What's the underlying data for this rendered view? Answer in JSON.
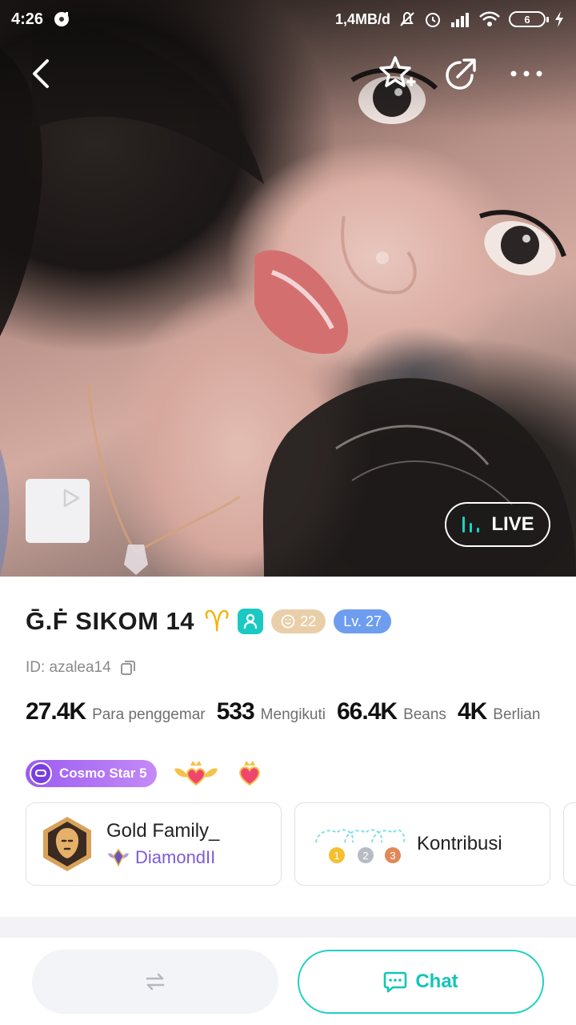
{
  "status_bar": {
    "time": "4:26",
    "network_speed": "1,4MB/d",
    "battery_level": "6"
  },
  "hero": {
    "live_label": "LIVE"
  },
  "profile": {
    "username": "Ḡ.Ḟ SIKOM 14",
    "zodiac_symbol": "♈",
    "age": "22",
    "level": "Lv. 27",
    "id_text": "ID: azalea14"
  },
  "stats": [
    {
      "value": "27.4K",
      "label": "Para penggemar"
    },
    {
      "value": "533",
      "label": "Mengikuti"
    },
    {
      "value": "66.4K",
      "label": "Beans"
    },
    {
      "value": "4K",
      "label": "Berlian"
    }
  ],
  "badges": {
    "cosmo_star": "Cosmo Star 5"
  },
  "family_card": {
    "title": "Gold Family_",
    "rank": "DiamondII"
  },
  "contribution_card": {
    "title": "Kontribusi",
    "ranks": [
      "1",
      "2",
      "3"
    ]
  },
  "bottom_bar": {
    "chat_label": "Chat"
  },
  "colors": {
    "accent_teal": "#1fd0c0",
    "level_blue": "#6e9df0",
    "age_beige": "#e9cfa9",
    "cosmo_purple": "#9b5cf0",
    "family_purple": "#7c5bd6"
  }
}
